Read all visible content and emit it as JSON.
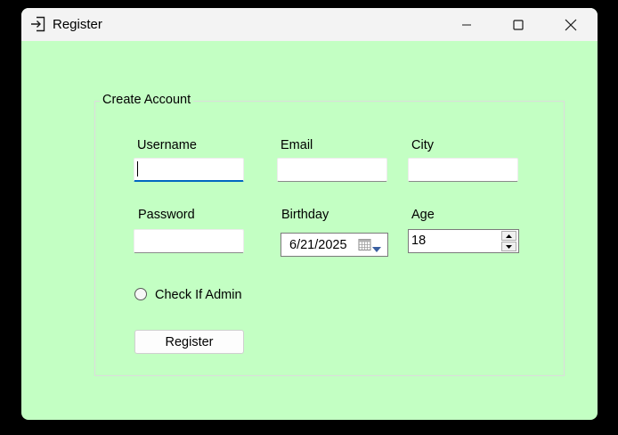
{
  "window": {
    "title": "Register"
  },
  "group": {
    "legend": "Create Account"
  },
  "form": {
    "username_label": "Username",
    "email_label": "Email",
    "city_label": "City",
    "password_label": "Password",
    "birthday_label": "Birthday",
    "age_label": "Age",
    "username_value": "",
    "email_value": "",
    "city_value": "",
    "password_value": "",
    "birthday_value": "6/21/2025",
    "age_value": "18",
    "admin_label": "Check If Admin",
    "admin_checked": false,
    "register_label": "Register"
  },
  "icons": {
    "app": "sign-in-icon",
    "minimize": "minimize-icon",
    "maximize": "maximize-icon",
    "close": "close-icon",
    "calendar": "calendar-icon",
    "dropdown": "chevron-down-icon",
    "spin_up": "chevron-up-icon",
    "spin_down": "chevron-down-icon"
  },
  "colors": {
    "window_background": "#c3ffc3",
    "titlebar_background": "#f3f3f3",
    "focus_accent": "#0067c0"
  }
}
